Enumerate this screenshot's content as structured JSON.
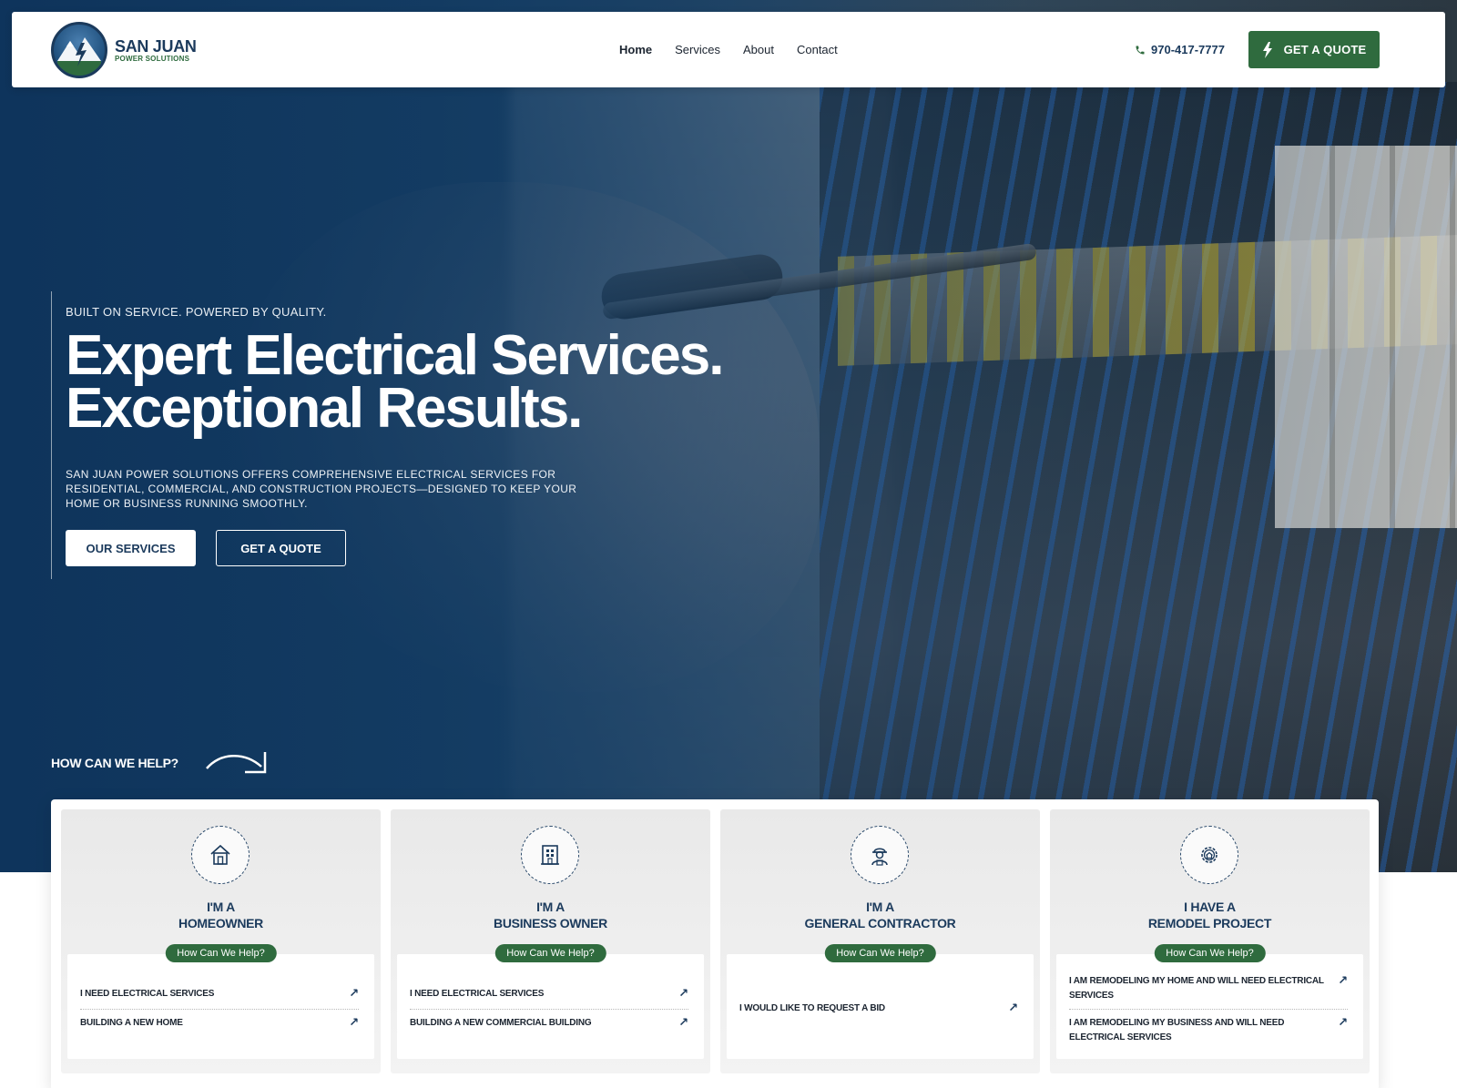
{
  "brand": {
    "name": "SAN JUAN",
    "tagline": "POWER SOLUTIONS"
  },
  "nav": {
    "items": [
      {
        "label": "Home",
        "active": true
      },
      {
        "label": "Services",
        "active": false
      },
      {
        "label": "About",
        "active": false
      },
      {
        "label": "Contact",
        "active": false
      }
    ]
  },
  "header": {
    "phone": "970-417-7777",
    "phone_icon": "phone-icon",
    "cta_label": "GET A QUOTE",
    "cta_icon": "bolt-icon"
  },
  "hero": {
    "eyebrow": "BUILT ON SERVICE. POWERED BY QUALITY.",
    "headline_line1": "Expert Electrical Services.",
    "headline_line2": "Exceptional Results.",
    "lede": "SAN JUAN POWER SOLUTIONS OFFERS COMPREHENSIVE ELECTRICAL SERVICES FOR RESIDENTIAL, COMMERCIAL, AND CONSTRUCTION PROJECTS—DESIGNED TO KEEP YOUR HOME OR BUSINESS RUNNING SMOOTHLY.",
    "primary_button": "OUR SERVICES",
    "secondary_button": "GET A QUOTE",
    "help_label": "HOW CAN WE HELP?"
  },
  "cards": [
    {
      "icon": "house-icon",
      "kicker": "I'M A",
      "title": "HOMEOWNER",
      "pill": "How Can We Help?",
      "options": [
        "I NEED ELECTRICAL SERVICES",
        "BUILDING A NEW HOME"
      ]
    },
    {
      "icon": "building-icon",
      "kicker": "I'M A",
      "title": "BUSINESS OWNER",
      "pill": "How Can We Help?",
      "options": [
        "I NEED ELECTRICAL SERVICES",
        "BUILDING A NEW COMMERCIAL BUILDING"
      ]
    },
    {
      "icon": "worker-icon",
      "kicker": "I'M A",
      "title": "GENERAL CONTRACTOR",
      "pill": "How Can We Help?",
      "options": [
        "I WOULD LIKE TO REQUEST A BID"
      ]
    },
    {
      "icon": "gear-house-icon",
      "kicker": "I HAVE A",
      "title": "REMODEL PROJECT",
      "pill": "How Can We Help?",
      "options": [
        "I AM REMODELING MY HOME AND WILL NEED ELECTRICAL SERVICES",
        "I AM REMODELING MY BUSINESS AND WILL NEED ELECTRICAL SERVICES"
      ]
    }
  ],
  "colors": {
    "navy": "#1b3a5c",
    "green": "#2f6b3e",
    "white": "#ffffff"
  }
}
